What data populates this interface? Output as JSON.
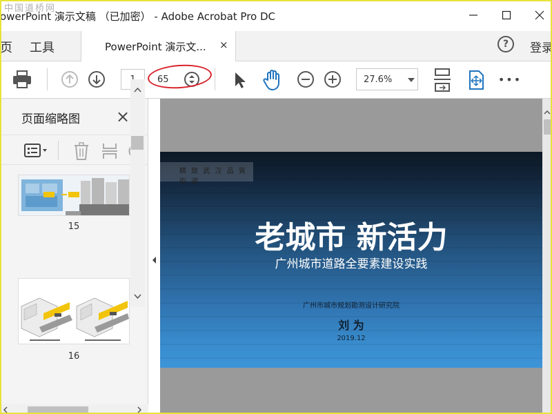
{
  "window": {
    "title": "owerPoint 演示文稿 （已加密） - Adobe Acrobat Pro DC",
    "watermark": "中国道桥网"
  },
  "tabs": {
    "home_label": "页",
    "tools_label": "工具",
    "document_label": "PowerPoint 演示文...",
    "close_glyph": "×",
    "help_glyph": "?",
    "login_label": "登录"
  },
  "toolbar": {
    "current_page": "1",
    "total_pages": "65",
    "zoom": "27.6%",
    "more_glyph": "•••"
  },
  "sidebar": {
    "title": "页面缩略图",
    "close_glyph": "×",
    "thumbnails": [
      {
        "page": "15"
      },
      {
        "page": "16"
      }
    ]
  },
  "slide": {
    "logo_text": "精 致 武 汉   品 質 街 道",
    "title": "老城市  新活力",
    "subtitle": "广州城市道路全要素建设实践",
    "organization": "广州市城市规划勘测设计研究院",
    "author": "刘 为",
    "date": "2019.12"
  },
  "colors": {
    "accent_blue": "#1e73be",
    "annotation_ring": "#d9222a",
    "frame_yellow": "#e8e23a"
  }
}
